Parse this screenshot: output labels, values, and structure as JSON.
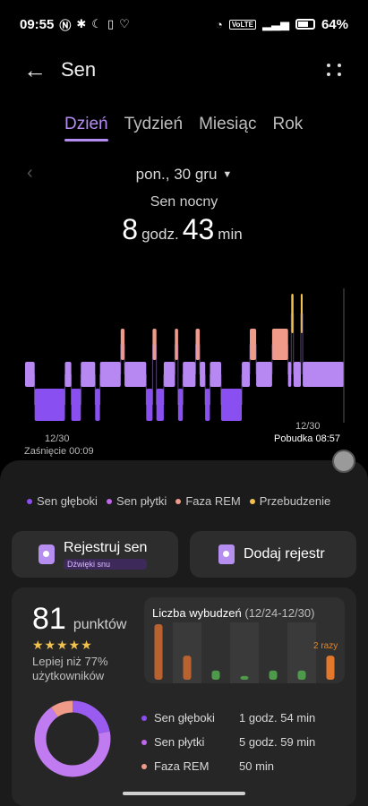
{
  "status_bar": {
    "time": "09:55",
    "icons_left": [
      "nfc-icon",
      "bluetooth-icon",
      "moon-icon",
      "vibrate-icon",
      "heart-icon"
    ],
    "icons_right": [
      "wifi-icon",
      "volte-icon",
      "signal-icon",
      "battery-icon"
    ],
    "volte": "VoLTE",
    "battery": "64%"
  },
  "header": {
    "title": "Sen"
  },
  "tabs": [
    "Dzień",
    "Tydzień",
    "Miesiąc",
    "Rok"
  ],
  "active_tab": "Dzień",
  "date": "pon., 30 gru",
  "summary": {
    "label": "Sen nocny",
    "hours": "8",
    "hours_unit": "godz.",
    "minutes": "43",
    "minutes_unit": "min"
  },
  "hypnogram": {
    "start_date": "12/30",
    "start_label": "Zaśnięcie 00:09",
    "end_date": "12/30",
    "end_label": "Pobudka 08:57",
    "colors": {
      "deep": "#8a4ff0",
      "light": "#b787f2",
      "rem": "#f09a8a",
      "awake": "#f2c14e"
    },
    "segments": [
      {
        "stage": "light",
        "from": 0.0,
        "to": 0.03
      },
      {
        "stage": "deep",
        "from": 0.03,
        "to": 0.125
      },
      {
        "stage": "light",
        "from": 0.125,
        "to": 0.145
      },
      {
        "stage": "deep",
        "from": 0.145,
        "to": 0.175
      },
      {
        "stage": "light",
        "from": 0.175,
        "to": 0.22
      },
      {
        "stage": "deep",
        "from": 0.22,
        "to": 0.235
      },
      {
        "stage": "light",
        "from": 0.235,
        "to": 0.3
      },
      {
        "stage": "rem",
        "from": 0.3,
        "to": 0.312
      },
      {
        "stage": "light",
        "from": 0.312,
        "to": 0.38
      },
      {
        "stage": "deep",
        "from": 0.38,
        "to": 0.4
      },
      {
        "stage": "rem",
        "from": 0.4,
        "to": 0.412
      },
      {
        "stage": "deep",
        "from": 0.412,
        "to": 0.435
      },
      {
        "stage": "light",
        "from": 0.435,
        "to": 0.47
      },
      {
        "stage": "rem",
        "from": 0.47,
        "to": 0.48
      },
      {
        "stage": "deep",
        "from": 0.48,
        "to": 0.495
      },
      {
        "stage": "light",
        "from": 0.495,
        "to": 0.535
      },
      {
        "stage": "rem",
        "from": 0.535,
        "to": 0.548
      },
      {
        "stage": "light",
        "from": 0.548,
        "to": 0.565
      },
      {
        "stage": "deep",
        "from": 0.565,
        "to": 0.58
      },
      {
        "stage": "light",
        "from": 0.58,
        "to": 0.615
      },
      {
        "stage": "deep",
        "from": 0.615,
        "to": 0.68
      },
      {
        "stage": "light",
        "from": 0.68,
        "to": 0.705
      },
      {
        "stage": "rem",
        "from": 0.705,
        "to": 0.725
      },
      {
        "stage": "light",
        "from": 0.725,
        "to": 0.775
      },
      {
        "stage": "rem",
        "from": 0.775,
        "to": 0.825
      },
      {
        "stage": "light",
        "from": 0.825,
        "to": 0.835
      },
      {
        "stage": "awake",
        "from": 0.835,
        "to": 0.842
      },
      {
        "stage": "light",
        "from": 0.842,
        "to": 0.865
      },
      {
        "stage": "awake",
        "from": 0.865,
        "to": 0.871
      },
      {
        "stage": "light",
        "from": 0.871,
        "to": 1.0
      }
    ]
  },
  "legend": [
    {
      "label": "Sen głęboki",
      "color": "#8a4ff0"
    },
    {
      "label": "Sen płytki",
      "color": "#c066e8"
    },
    {
      "label": "Faza REM",
      "color": "#f09a8a"
    },
    {
      "label": "Przebudzenie",
      "color": "#f2c14e"
    }
  ],
  "buttons": {
    "register": {
      "label": "Rejestruj sen",
      "sub": "Dźwięki snu"
    },
    "add": {
      "label": "Dodaj rejestr"
    }
  },
  "score": {
    "value": "81",
    "unit": "punktów",
    "stars": "★★★★★",
    "desc": "Lepiej niż 77% użytkowników"
  },
  "wakeups": {
    "title": "Liczba wybudzeń",
    "range": "(12/24-12/30)",
    "note": "2 razy",
    "bars": [
      {
        "value": 6,
        "color": "#b8622f"
      },
      {
        "value": 2.6,
        "color": "#b8622f"
      },
      {
        "value": 1,
        "color": "#4d9a4a"
      },
      {
        "value": 0.4,
        "color": "#4d9a4a"
      },
      {
        "value": 1,
        "color": "#4d9a4a"
      },
      {
        "value": 1,
        "color": "#4d9a4a"
      },
      {
        "value": 2.6,
        "color": "#e3772b"
      }
    ]
  },
  "breakdown": [
    {
      "label": "Sen głęboki",
      "value": "1 godz. 54 min",
      "color": "#8a4ff0"
    },
    {
      "label": "Sen płytki",
      "value": "5 godz. 59 min",
      "color": "#c066e8"
    },
    {
      "label": "Faza REM",
      "value": "50 min",
      "color": "#f09a8a"
    }
  ],
  "donut": {
    "fractions": [
      {
        "stage": "deep",
        "value": 0.218,
        "color": "#9a5cf0"
      },
      {
        "stage": "light",
        "value": 0.686,
        "color": "#c17bf0"
      },
      {
        "stage": "rem",
        "value": 0.096,
        "color": "#f09a8a"
      }
    ]
  }
}
